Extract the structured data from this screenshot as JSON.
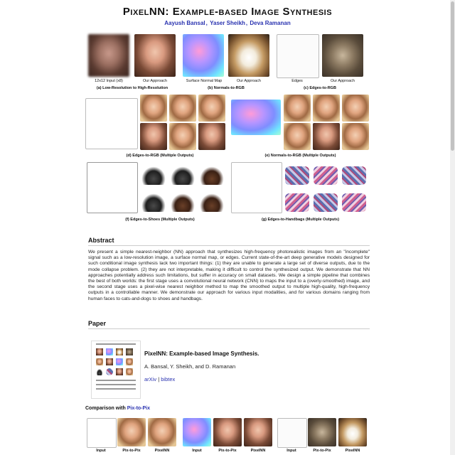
{
  "title": "PixelNN: Example-based Image Synthesis",
  "authors": [
    "Aayush Bansal",
    "Yaser Sheikh",
    "Deva Ramanan"
  ],
  "figure": {
    "row1": {
      "captions": [
        "12x12 Input (x8)",
        "Our Approach",
        "Surface Normal Map",
        "Our Approach",
        "Edges",
        "Our Approach"
      ],
      "subcaptions": [
        "(a) Low-Resolution to High-Resolution",
        "(b) Normals-to-RGB",
        "(c) Edges-to-RGB"
      ]
    },
    "row2": {
      "subcaptions": [
        "(d) Edges-to-RGB (Multiple Outputs)",
        "(e) Normals-to-RGB (Multiple Outputs)"
      ]
    },
    "row3": {
      "subcaptions": [
        "(f) Edges-to-Shoes (Multiple Outputs)",
        "(g) Edges-to-Handbags (Multiple Outputs)"
      ]
    }
  },
  "sections": {
    "abstract_heading": "Abstract",
    "abstract_text": "We present a simple nearest-neighbor (NN) approach that synthesizes high-frequency photorealistic images from an \"incomplete\" signal such as a low-resolution image, a surface normal map, or edges. Current state-of-the-art deep generative models designed for such conditional image synthesis lack two important things: (1) they are unable to generate a large set of diverse outputs, due to the mode collapse problem. (2) they are not interpretable, making it difficult to control the synthesized output. We demonstrate that NN approaches potentially address such limitations, but suffer in accuracy on small datasets. We design a simple pipeline that combines the best of both worlds: the first stage uses a convolutional neural network (CNN) to maps the input to a (overly-smoothed) image, and the second stage uses a pixel-wise nearest neighbor method to map the smoothed output to multiple high-quality, high-frequency outputs in a controllable manner. We demonstrate our approach for various input modalities, and for various domains ranging from human faces to cats-and-dogs to shoes and handbags.",
    "paper_heading": "Paper",
    "paper_title": "PixelNN: Example-based Image Synthesis.",
    "paper_authors": "A. Bansal, Y. Sheikh, and D. Ramanan",
    "links": [
      "arXiv",
      "bibtex"
    ],
    "link_separator": "|",
    "comparison_prefix": "Comparison with ",
    "comparison_link": "Pix-to-Pix"
  },
  "comparison_labels": [
    "Input",
    "Pix-to-Pix",
    "PixelNN",
    "Input",
    "Pix-to-Pix",
    "PixelNN",
    "Input",
    "Pix-to-Pix",
    "PixelNN"
  ]
}
